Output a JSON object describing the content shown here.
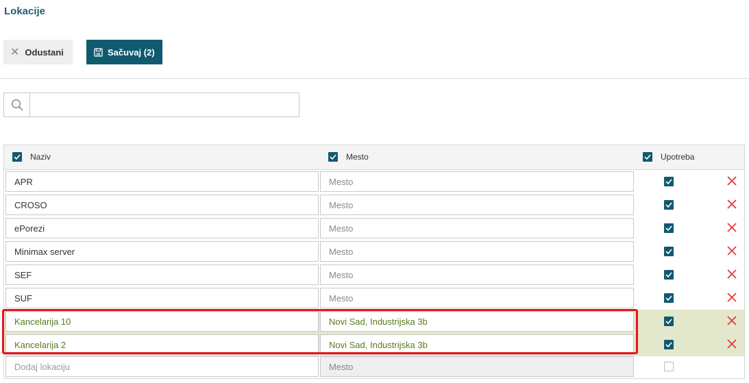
{
  "page": {
    "title": "Lokacije"
  },
  "toolbar": {
    "cancel_label": "Odustani",
    "save_label": "Sačuvaj (2)"
  },
  "search": {
    "value": "",
    "placeholder": ""
  },
  "table": {
    "columns": [
      "Naziv",
      "Mesto",
      "Upotreba"
    ],
    "rows": [
      {
        "name": "APR",
        "place": "",
        "place_placeholder": "Mesto",
        "in_use": true,
        "highlighted": false
      },
      {
        "name": "CROSO",
        "place": "",
        "place_placeholder": "Mesto",
        "in_use": true,
        "highlighted": false
      },
      {
        "name": "ePorezi",
        "place": "",
        "place_placeholder": "Mesto",
        "in_use": true,
        "highlighted": false
      },
      {
        "name": "Minimax server",
        "place": "",
        "place_placeholder": "Mesto",
        "in_use": true,
        "highlighted": false
      },
      {
        "name": "SEF",
        "place": "",
        "place_placeholder": "Mesto",
        "in_use": true,
        "highlighted": false
      },
      {
        "name": "SUF",
        "place": "",
        "place_placeholder": "Mesto",
        "in_use": true,
        "highlighted": false
      },
      {
        "name": "Kancelarija 10",
        "place": "Novi Sad, Industrijska 3b",
        "place_placeholder": "Mesto",
        "in_use": true,
        "highlighted": true
      },
      {
        "name": "Kancelarija  2",
        "place": "Novi Sad, Industrijska 3b",
        "place_placeholder": "Mesto",
        "in_use": true,
        "highlighted": true
      }
    ],
    "new_row": {
      "name_placeholder": "Dodaj lokaciju",
      "place_placeholder": "Mesto",
      "in_use": false
    }
  },
  "colors": {
    "accent": "#105a70",
    "title": "#1f5f74",
    "highlight_row": "#e3e8cc",
    "highlight_text": "#5a7a1f",
    "delete": "#e23a3a",
    "annotation_box": "#e8141e"
  },
  "icons": {
    "cancel": "close-icon",
    "save": "floppy-disk-icon",
    "search": "search-icon",
    "delete": "delete-x-icon",
    "check": "checkmark-icon"
  }
}
